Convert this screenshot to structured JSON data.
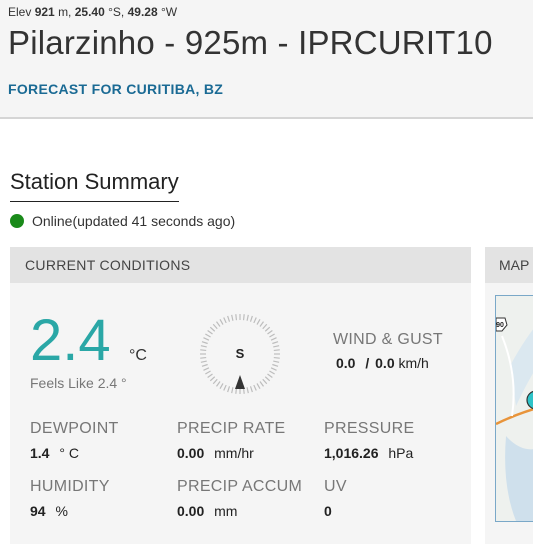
{
  "header": {
    "elev_label": "Elev",
    "elev_value": "921",
    "elev_unit": "m,",
    "lat_value": "25.40",
    "lat_unit": "°S,",
    "lon_value": "49.28",
    "lon_unit": "°W",
    "title": "Pilarzinho - 925m - IPRCURIT10",
    "forecast_link": "FORECAST FOR CURITIBA, BZ"
  },
  "summary": {
    "title": "Station Summary",
    "status_text": "Online(updated 41 seconds ago)",
    "status_color": "#1a8a1a"
  },
  "conditions": {
    "header": "CURRENT CONDITIONS",
    "temperature": "2.4",
    "temperature_unit": "°C",
    "feels_like": "Feels Like 2.4 °",
    "wind_direction": "S",
    "wind_label": "WIND & GUST",
    "wind_value": "0.0",
    "wind_separator": "/",
    "gust_value": "0.0",
    "wind_unit": "km/h",
    "dewpoint_label": "DEWPOINT",
    "dewpoint_value": "1.4",
    "dewpoint_unit": "° C",
    "precip_rate_label": "PRECIP RATE",
    "precip_rate_value": "0.00",
    "precip_rate_unit": "mm/hr",
    "pressure_label": "PRESSURE",
    "pressure_value": "1,016.26",
    "pressure_unit": "hPa",
    "humidity_label": "HUMIDITY",
    "humidity_value": "94",
    "humidity_unit": "%",
    "precip_accum_label": "PRECIP ACCUM",
    "precip_accum_value": "0.00",
    "precip_accum_unit": "mm",
    "uv_label": "UV",
    "uv_value": "0"
  },
  "map": {
    "header": "MAP",
    "road_shield": "90"
  },
  "colors": {
    "accent_teal": "#2aa7a6",
    "link_blue": "#1a6a94"
  }
}
